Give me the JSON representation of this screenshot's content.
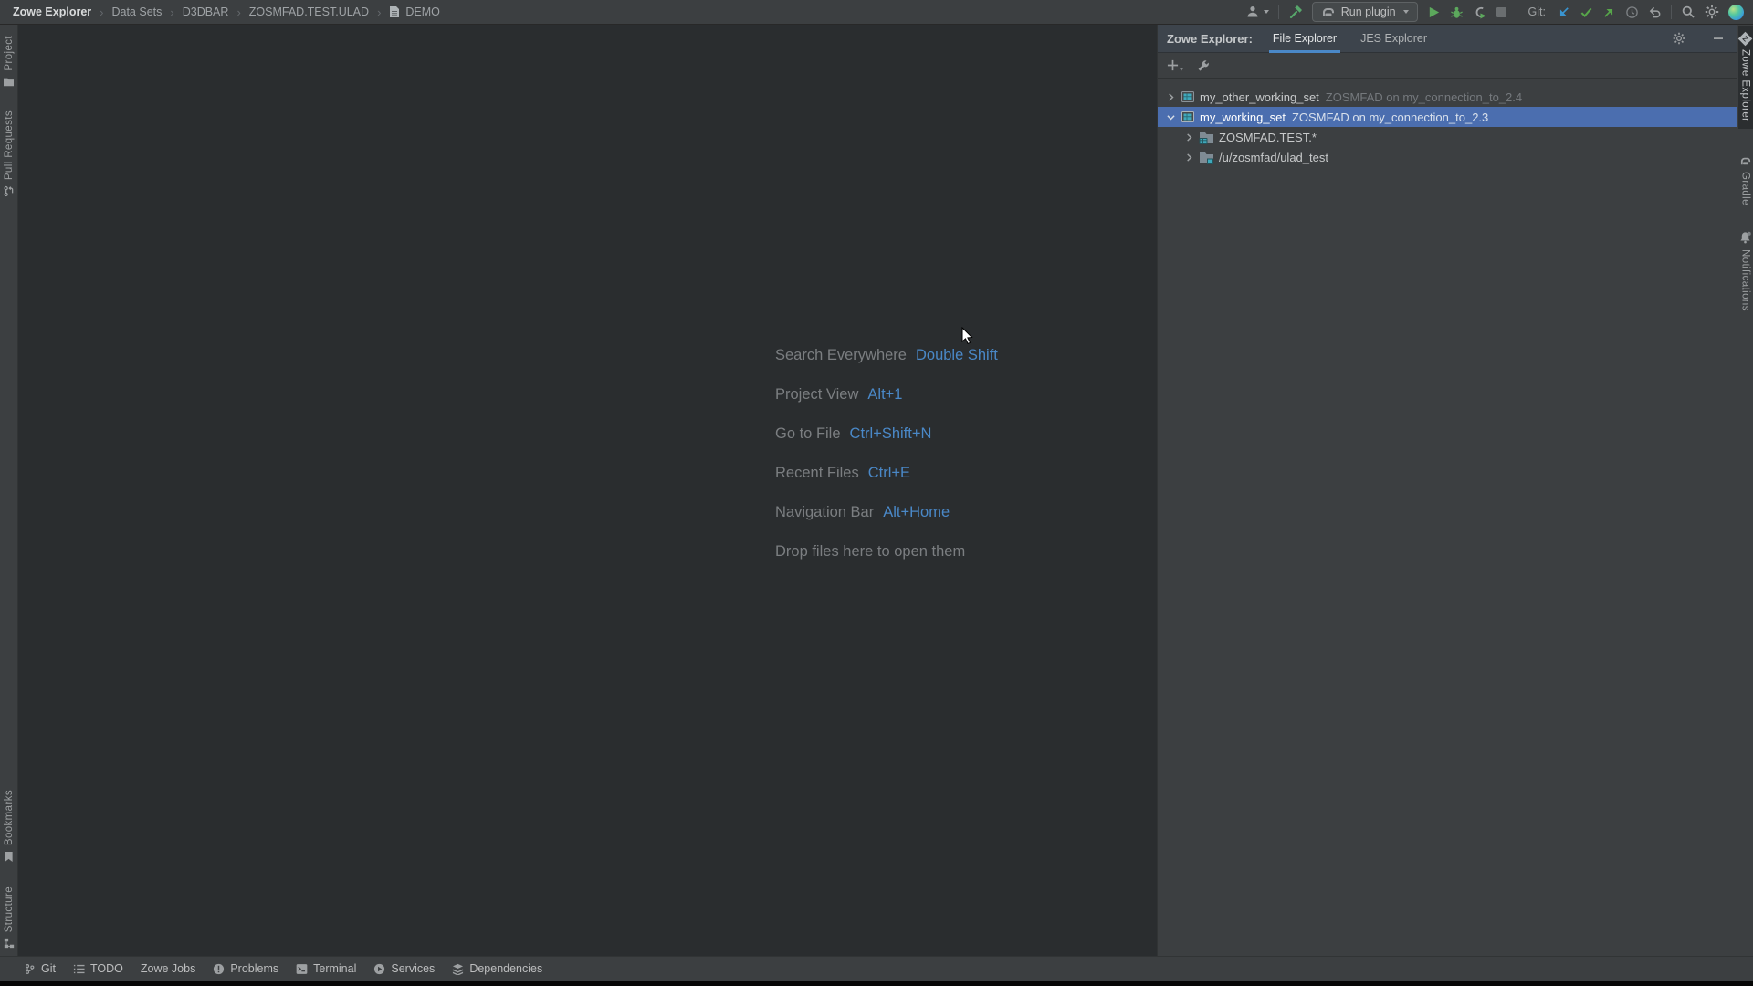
{
  "topbar": {
    "breadcrumbs": [
      "Zowe Explorer",
      "Data Sets",
      "D3DBAR",
      "ZOSMFAD.TEST.ULAD",
      "DEMO"
    ],
    "run_button_label": "Run plugin",
    "git_label": "Git:"
  },
  "left_stripe": {
    "top": [
      {
        "label": "Project",
        "icon": "folder-icon"
      },
      {
        "label": "Pull Requests",
        "icon": "pull-request-icon"
      }
    ],
    "bottom": [
      {
        "label": "Bookmarks",
        "icon": "bookmark-icon"
      },
      {
        "label": "Structure",
        "icon": "structure-icon"
      }
    ]
  },
  "right_stripe": {
    "items": [
      {
        "label": "Zowe Explorer",
        "icon": "zowe-diamond-icon",
        "active": true
      },
      {
        "label": "Gradle",
        "icon": "gradle-elephant-icon",
        "active": false
      },
      {
        "label": "Notifications",
        "icon": "bell-icon",
        "active": false
      }
    ]
  },
  "right_panel": {
    "title": "Zowe Explorer:",
    "tabs": [
      {
        "label": "File Explorer",
        "active": true
      },
      {
        "label": "JES Explorer",
        "active": false
      }
    ],
    "tree": [
      {
        "level": 0,
        "expanded": false,
        "selected": false,
        "icon": "working-set-icon",
        "name": "my_other_working_set",
        "detail": "ZOSMFAD on my_connection_to_2.4"
      },
      {
        "level": 0,
        "expanded": true,
        "selected": true,
        "icon": "working-set-icon",
        "name": "my_working_set",
        "detail": "ZOSMFAD on my_connection_to_2.3"
      },
      {
        "level": 1,
        "expanded": false,
        "selected": false,
        "icon": "dataset-folder-icon",
        "name": "ZOSMFAD.TEST.*",
        "detail": ""
      },
      {
        "level": 1,
        "expanded": false,
        "selected": false,
        "icon": "uss-folder-icon",
        "name": "/u/zosmfad/ulad_test",
        "detail": ""
      }
    ]
  },
  "editor": {
    "shortcuts": [
      {
        "label": "Search Everywhere",
        "keys": "Double Shift"
      },
      {
        "label": "Project View",
        "keys": "Alt+1"
      },
      {
        "label": "Go to File",
        "keys": "Ctrl+Shift+N"
      },
      {
        "label": "Recent Files",
        "keys": "Ctrl+E"
      },
      {
        "label": "Navigation Bar",
        "keys": "Alt+Home"
      },
      {
        "label": "Drop files here to open them",
        "keys": ""
      }
    ]
  },
  "statusbar": {
    "items": [
      {
        "label": "Git",
        "icon": "git-branch-icon"
      },
      {
        "label": "TODO",
        "icon": "todo-list-icon"
      },
      {
        "label": "Zowe Jobs",
        "icon": ""
      },
      {
        "label": "Problems",
        "icon": "problems-icon"
      },
      {
        "label": "Terminal",
        "icon": "terminal-icon"
      },
      {
        "label": "Services",
        "icon": "services-icon"
      },
      {
        "label": "Dependencies",
        "icon": "dependencies-icon"
      }
    ]
  },
  "icons": {
    "toolbar_right": [
      "user-icon",
      "build-hammer-icon",
      "gradle-elephant-icon",
      "run-icon",
      "debug-icon",
      "coverage-icon",
      "stop-icon",
      "git-update-icon",
      "git-commit-icon",
      "git-push-icon",
      "history-icon",
      "rollback-icon",
      "search-icon",
      "gear-icon",
      "avatar-sphere-icon"
    ],
    "panel_toolbar": [
      "add-icon",
      "wrench-icon"
    ],
    "panel_header": [
      "gear-icon",
      "minimize-icon"
    ]
  },
  "colors": {
    "selection_blue": "#4b6eaf",
    "shortcut_key_blue": "#4a88c7",
    "tab_underline_blue": "#4a88c7",
    "run_green": "#5ca85c",
    "git_update_blue": "#3994d0",
    "panel_bg": "#3c3f41",
    "editor_bg": "#2a2d2f"
  }
}
